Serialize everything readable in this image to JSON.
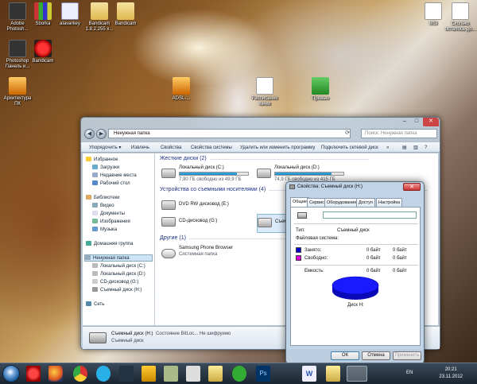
{
  "desktop": {
    "icons": [
      {
        "label": "Adobe Photosh...",
        "kind": "g-dark"
      },
      {
        "label": "Sborka",
        "kind": "g-book"
      },
      {
        "label": "alavarkey",
        "kind": "g-win"
      },
      {
        "label": "Bandicam 1.8.2.255 x...",
        "kind": "g-folder"
      },
      {
        "label": "Bandicam",
        "kind": "g-folder"
      },
      {
        "label": "Photoshop Панель и...",
        "kind": "g-dark"
      },
      {
        "label": "Bandicam",
        "kind": "g-red"
      },
      {
        "label": "Архитектура ПК",
        "kind": "g-orange"
      },
      {
        "label": "MSI",
        "kind": "g-doc"
      },
      {
        "label": "Сколько осталось до...",
        "kind": "g-doc"
      },
      {
        "label": "ADSL-...",
        "kind": "g-orange"
      },
      {
        "label": "Расписание качки",
        "kind": "g-doc"
      },
      {
        "label": "Превью",
        "kind": "g-green"
      }
    ]
  },
  "explorer": {
    "address": "Ненужная папка",
    "search_placeholder": "Поиск: Ненужная папка",
    "toolbar": [
      "Упорядочить ▾",
      "Извлечь",
      "Свойства",
      "Свойства системы",
      "Удалить или изменить программу",
      "Подключить сетевой диск",
      "»"
    ],
    "nav": {
      "favorites": "Избранное",
      "fav_items": [
        "Загрузки",
        "Недавние места",
        "Рабочий стол"
      ],
      "libraries": "Библиотеки",
      "lib_items": [
        "Видео",
        "Документы",
        "Изображения",
        "Музыка"
      ],
      "homegroup": "Домашняя группа",
      "folder": "Ненужная папка",
      "folder_items": [
        "Локальный диск (C:)",
        "Локальный диск (D:)",
        "CD-дисковод (G:)",
        "Съемный диск (H:)"
      ],
      "network": "Сеть"
    },
    "groups": {
      "hdd": "Жесткие диски (2)",
      "removable": "Устройства со съемными носителями (4)",
      "other": "Другие (1)"
    },
    "drives": [
      {
        "name": "Локальный диск (C:)",
        "free": "7,90 ГБ свободно из 49,9 ГБ",
        "used_fraction": 0.84
      },
      {
        "name": "Локальный диск (D:)",
        "free": "74,9 ГБ свободно из 415 ГБ",
        "used_fraction": 0.82
      }
    ],
    "removable": [
      {
        "name": "DVD RW дисковод (E:)"
      },
      {
        "name": "CD-дисковод (G:)"
      },
      {
        "name": "Съем"
      }
    ],
    "other": {
      "name": "Samsung Phone Browser",
      "type": "Системная папка"
    },
    "details": {
      "name": "Съемный диск (H:)",
      "type": "Съемный диск",
      "bitlocker": "Состояние BitLoc... Не шифруемо"
    }
  },
  "dialog": {
    "title": "Свойства: Съемный диск (H:)",
    "tabs": [
      "Общие",
      "Сервис",
      "Оборудование",
      "Доступ",
      "Настройка"
    ],
    "type_label": "Тип:",
    "type_value": "Съемный диск",
    "fs_label": "Файловая система:",
    "used_label": "Занято:",
    "used_value": "0 байт",
    "used_value2": "0 байт",
    "free_label": "Свободно:",
    "free_value": "0 байт",
    "free_value2": "0 байт",
    "capacity_label": "Емкость:",
    "capacity_value": "0 байт",
    "capacity_value2": "0 байт",
    "disk_label": "Диск H:",
    "buttons": {
      "ok": "ОК",
      "cancel": "Отмена",
      "apply": "Применить"
    },
    "colors": {
      "used": "#0000cc",
      "free": "#dd00dd",
      "pie": "#1a1aff"
    }
  },
  "taskbar": {
    "lang": "EN",
    "time": "20:21",
    "date": "23.11.2012",
    "apps": [
      "opera",
      "firefox",
      "chrome",
      "skype",
      "steam",
      "aimp",
      "game",
      "notepad",
      "explorer",
      "utorrent",
      "photoshop",
      "word",
      "folder"
    ]
  }
}
